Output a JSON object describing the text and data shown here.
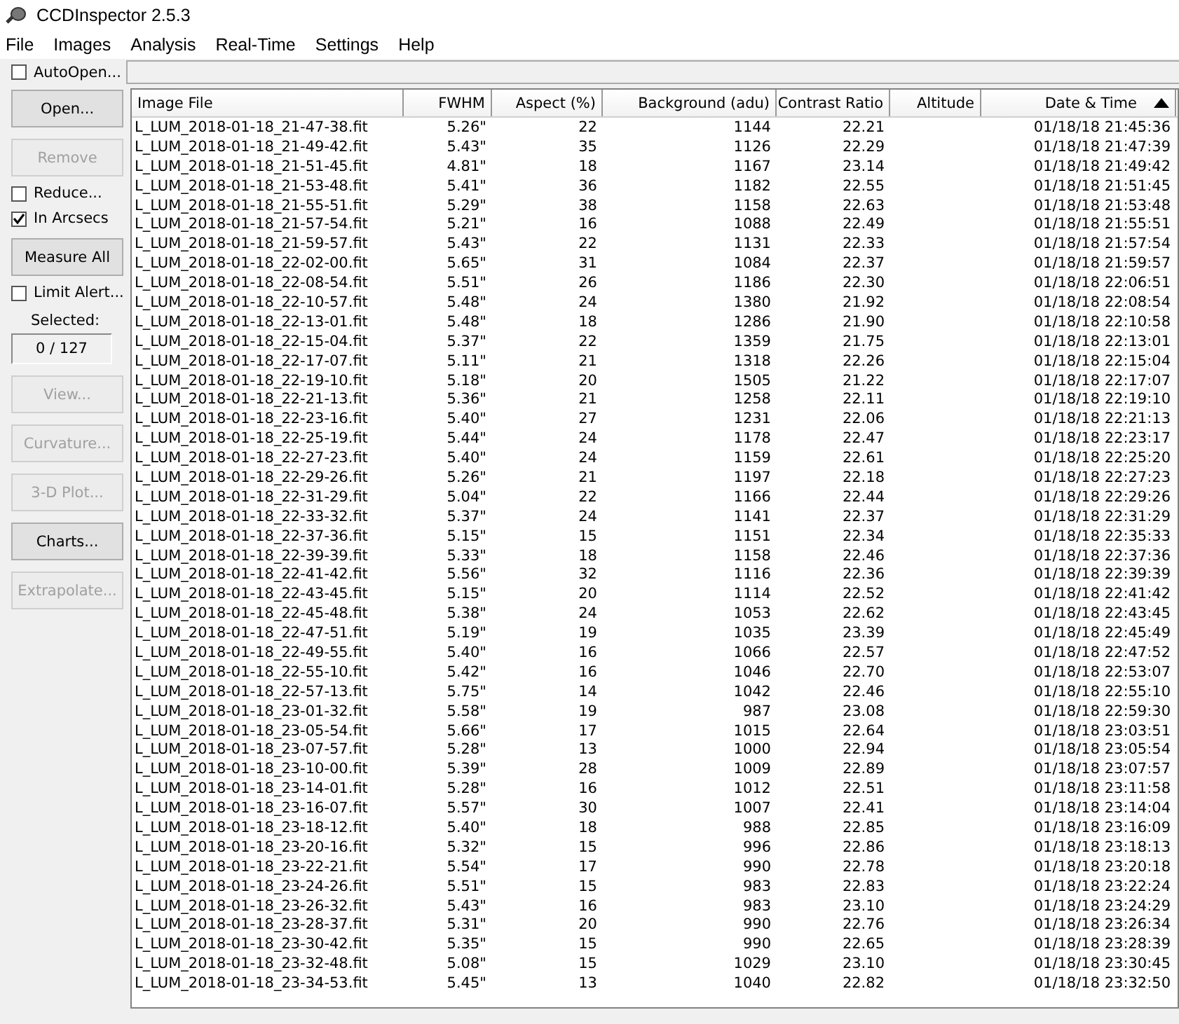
{
  "window": {
    "title": "CCDInspector 2.5.3"
  },
  "menu": [
    "File",
    "Images",
    "Analysis",
    "Real-Time",
    "Settings",
    "Help"
  ],
  "toolbar": {
    "auto_open": {
      "label": "AutoOpen...",
      "checked": false
    }
  },
  "sidebar": [
    {
      "kind": "button",
      "label": "Open...",
      "disabled": false
    },
    {
      "kind": "button",
      "label": "Remove",
      "disabled": true
    },
    {
      "kind": "checkbox",
      "label": "Reduce...",
      "checked": false
    },
    {
      "kind": "checkbox",
      "label": "In Arcsecs",
      "checked": true
    },
    {
      "kind": "button",
      "label": "Measure All",
      "disabled": false
    },
    {
      "kind": "checkbox",
      "label": "Limit Alert...",
      "checked": false
    },
    {
      "kind": "label",
      "label": "Selected:"
    },
    {
      "kind": "readout",
      "label": "0 / 127"
    },
    {
      "kind": "button",
      "label": "View...",
      "disabled": true
    },
    {
      "kind": "button",
      "label": "Curvature...",
      "disabled": true
    },
    {
      "kind": "button",
      "label": "3-D Plot...",
      "disabled": true
    },
    {
      "kind": "button",
      "label": "Charts...",
      "disabled": false
    },
    {
      "kind": "button",
      "label": "Extrapolate...",
      "disabled": true
    }
  ],
  "table": {
    "columns": [
      {
        "label": "Image File",
        "sorted": false
      },
      {
        "label": "FWHM",
        "sorted": false
      },
      {
        "label": "Aspect (%)",
        "sorted": false
      },
      {
        "label": "Background (adu)",
        "sorted": false
      },
      {
        "label": "Contrast Ratio",
        "sorted": false
      },
      {
        "label": "Altitude",
        "sorted": false
      },
      {
        "label": "Date & Time",
        "sorted": true
      }
    ],
    "rows": [
      [
        "L_LUM_2018-01-18_21-47-38.fit",
        "5.26\"",
        "22",
        "1144",
        "22.21",
        "",
        "01/18/18 21:45:36"
      ],
      [
        "L_LUM_2018-01-18_21-49-42.fit",
        "5.43\"",
        "35",
        "1126",
        "22.29",
        "",
        "01/18/18 21:47:39"
      ],
      [
        "L_LUM_2018-01-18_21-51-45.fit",
        "4.81\"",
        "18",
        "1167",
        "23.14",
        "",
        "01/18/18 21:49:42"
      ],
      [
        "L_LUM_2018-01-18_21-53-48.fit",
        "5.41\"",
        "36",
        "1182",
        "22.55",
        "",
        "01/18/18 21:51:45"
      ],
      [
        "L_LUM_2018-01-18_21-55-51.fit",
        "5.29\"",
        "38",
        "1158",
        "22.63",
        "",
        "01/18/18 21:53:48"
      ],
      [
        "L_LUM_2018-01-18_21-57-54.fit",
        "5.21\"",
        "16",
        "1088",
        "22.49",
        "",
        "01/18/18 21:55:51"
      ],
      [
        "L_LUM_2018-01-18_21-59-57.fit",
        "5.43\"",
        "22",
        "1131",
        "22.33",
        "",
        "01/18/18 21:57:54"
      ],
      [
        "L_LUM_2018-01-18_22-02-00.fit",
        "5.65\"",
        "31",
        "1084",
        "22.37",
        "",
        "01/18/18 21:59:57"
      ],
      [
        "L_LUM_2018-01-18_22-08-54.fit",
        "5.51\"",
        "26",
        "1186",
        "22.30",
        "",
        "01/18/18 22:06:51"
      ],
      [
        "L_LUM_2018-01-18_22-10-57.fit",
        "5.48\"",
        "24",
        "1380",
        "21.92",
        "",
        "01/18/18 22:08:54"
      ],
      [
        "L_LUM_2018-01-18_22-13-01.fit",
        "5.48\"",
        "18",
        "1286",
        "21.90",
        "",
        "01/18/18 22:10:58"
      ],
      [
        "L_LUM_2018-01-18_22-15-04.fit",
        "5.37\"",
        "22",
        "1359",
        "21.75",
        "",
        "01/18/18 22:13:01"
      ],
      [
        "L_LUM_2018-01-18_22-17-07.fit",
        "5.11\"",
        "21",
        "1318",
        "22.26",
        "",
        "01/18/18 22:15:04"
      ],
      [
        "L_LUM_2018-01-18_22-19-10.fit",
        "5.18\"",
        "20",
        "1505",
        "21.22",
        "",
        "01/18/18 22:17:07"
      ],
      [
        "L_LUM_2018-01-18_22-21-13.fit",
        "5.36\"",
        "21",
        "1258",
        "22.11",
        "",
        "01/18/18 22:19:10"
      ],
      [
        "L_LUM_2018-01-18_22-23-16.fit",
        "5.40\"",
        "27",
        "1231",
        "22.06",
        "",
        "01/18/18 22:21:13"
      ],
      [
        "L_LUM_2018-01-18_22-25-19.fit",
        "5.44\"",
        "24",
        "1178",
        "22.47",
        "",
        "01/18/18 22:23:17"
      ],
      [
        "L_LUM_2018-01-18_22-27-23.fit",
        "5.40\"",
        "24",
        "1159",
        "22.61",
        "",
        "01/18/18 22:25:20"
      ],
      [
        "L_LUM_2018-01-18_22-29-26.fit",
        "5.26\"",
        "21",
        "1197",
        "22.18",
        "",
        "01/18/18 22:27:23"
      ],
      [
        "L_LUM_2018-01-18_22-31-29.fit",
        "5.04\"",
        "22",
        "1166",
        "22.44",
        "",
        "01/18/18 22:29:26"
      ],
      [
        "L_LUM_2018-01-18_22-33-32.fit",
        "5.37\"",
        "24",
        "1141",
        "22.37",
        "",
        "01/18/18 22:31:29"
      ],
      [
        "L_LUM_2018-01-18_22-37-36.fit",
        "5.15\"",
        "15",
        "1151",
        "22.34",
        "",
        "01/18/18 22:35:33"
      ],
      [
        "L_LUM_2018-01-18_22-39-39.fit",
        "5.33\"",
        "18",
        "1158",
        "22.46",
        "",
        "01/18/18 22:37:36"
      ],
      [
        "L_LUM_2018-01-18_22-41-42.fit",
        "5.56\"",
        "32",
        "1116",
        "22.36",
        "",
        "01/18/18 22:39:39"
      ],
      [
        "L_LUM_2018-01-18_22-43-45.fit",
        "5.15\"",
        "20",
        "1114",
        "22.52",
        "",
        "01/18/18 22:41:42"
      ],
      [
        "L_LUM_2018-01-18_22-45-48.fit",
        "5.38\"",
        "24",
        "1053",
        "22.62",
        "",
        "01/18/18 22:43:45"
      ],
      [
        "L_LUM_2018-01-18_22-47-51.fit",
        "5.19\"",
        "19",
        "1035",
        "23.39",
        "",
        "01/18/18 22:45:49"
      ],
      [
        "L_LUM_2018-01-18_22-49-55.fit",
        "5.40\"",
        "16",
        "1066",
        "22.57",
        "",
        "01/18/18 22:47:52"
      ],
      [
        "L_LUM_2018-01-18_22-55-10.fit",
        "5.42\"",
        "16",
        "1046",
        "22.70",
        "",
        "01/18/18 22:53:07"
      ],
      [
        "L_LUM_2018-01-18_22-57-13.fit",
        "5.75\"",
        "14",
        "1042",
        "22.46",
        "",
        "01/18/18 22:55:10"
      ],
      [
        "L_LUM_2018-01-18_23-01-32.fit",
        "5.58\"",
        "19",
        "987",
        "23.08",
        "",
        "01/18/18 22:59:30"
      ],
      [
        "L_LUM_2018-01-18_23-05-54.fit",
        "5.66\"",
        "17",
        "1015",
        "22.64",
        "",
        "01/18/18 23:03:51"
      ],
      [
        "L_LUM_2018-01-18_23-07-57.fit",
        "5.28\"",
        "13",
        "1000",
        "22.94",
        "",
        "01/18/18 23:05:54"
      ],
      [
        "L_LUM_2018-01-18_23-10-00.fit",
        "5.39\"",
        "28",
        "1009",
        "22.89",
        "",
        "01/18/18 23:07:57"
      ],
      [
        "L_LUM_2018-01-18_23-14-01.fit",
        "5.28\"",
        "16",
        "1012",
        "22.51",
        "",
        "01/18/18 23:11:58"
      ],
      [
        "L_LUM_2018-01-18_23-16-07.fit",
        "5.57\"",
        "30",
        "1007",
        "22.41",
        "",
        "01/18/18 23:14:04"
      ],
      [
        "L_LUM_2018-01-18_23-18-12.fit",
        "5.40\"",
        "18",
        "988",
        "22.85",
        "",
        "01/18/18 23:16:09"
      ],
      [
        "L_LUM_2018-01-18_23-20-16.fit",
        "5.32\"",
        "15",
        "996",
        "22.86",
        "",
        "01/18/18 23:18:13"
      ],
      [
        "L_LUM_2018-01-18_23-22-21.fit",
        "5.54\"",
        "17",
        "990",
        "22.78",
        "",
        "01/18/18 23:20:18"
      ],
      [
        "L_LUM_2018-01-18_23-24-26.fit",
        "5.51\"",
        "15",
        "983",
        "22.83",
        "",
        "01/18/18 23:22:24"
      ],
      [
        "L_LUM_2018-01-18_23-26-32.fit",
        "5.43\"",
        "16",
        "983",
        "23.10",
        "",
        "01/18/18 23:24:29"
      ],
      [
        "L_LUM_2018-01-18_23-28-37.fit",
        "5.31\"",
        "20",
        "990",
        "22.76",
        "",
        "01/18/18 23:26:34"
      ],
      [
        "L_LUM_2018-01-18_23-30-42.fit",
        "5.35\"",
        "15",
        "990",
        "22.65",
        "",
        "01/18/18 23:28:39"
      ],
      [
        "L_LUM_2018-01-18_23-32-48.fit",
        "5.08\"",
        "15",
        "1029",
        "23.10",
        "",
        "01/18/18 23:30:45"
      ],
      [
        "L_LUM_2018-01-18_23-34-53.fit",
        "5.45\"",
        "13",
        "1040",
        "22.82",
        "",
        "01/18/18 23:32:50"
      ]
    ]
  }
}
